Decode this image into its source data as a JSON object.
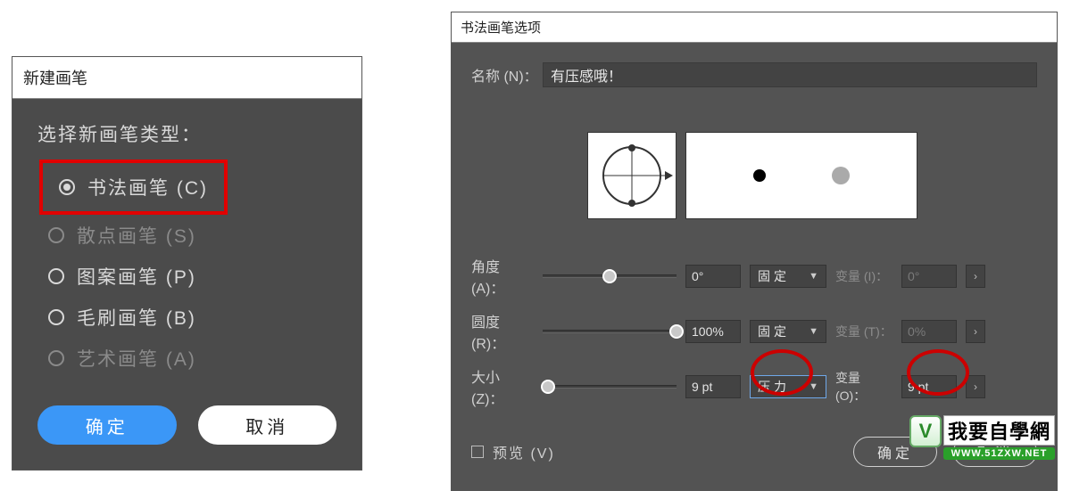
{
  "left": {
    "title": "新建画笔",
    "prompt": "选择新画笔类型：",
    "options": [
      {
        "label": "书法画笔 (C)",
        "selected": true,
        "dim": false
      },
      {
        "label": "散点画笔 (S)",
        "selected": false,
        "dim": true
      },
      {
        "label": "图案画笔 (P)",
        "selected": false,
        "dim": false
      },
      {
        "label": "毛刷画笔 (B)",
        "selected": false,
        "dim": false
      },
      {
        "label": "艺术画笔 (A)",
        "selected": false,
        "dim": true
      }
    ],
    "ok": "确定",
    "cancel": "取消"
  },
  "right": {
    "title": "书法画笔选项",
    "name_label": "名称 (N)：",
    "name_value": "有压感哦！",
    "params": {
      "angle": {
        "label": "角度 (A)：",
        "value": "0°",
        "mode": "固定",
        "var_label": "变量 (I)：",
        "var_value": "0°"
      },
      "round": {
        "label": "圆度 (R)：",
        "value": "100%",
        "mode": "固定",
        "var_label": "变量 (T)：",
        "var_value": "0%"
      },
      "size": {
        "label": "大小 (Z)：",
        "value": "9 pt",
        "mode": "压力",
        "var_label": "变量 (O)：",
        "var_value": "9 pt"
      }
    },
    "preview_label": "预览 (V)",
    "ok": "确定",
    "cancel": "取消"
  },
  "watermark": {
    "brand": "我要自學網",
    "url": "WWW.51ZXW.NET",
    "badge": "V"
  }
}
